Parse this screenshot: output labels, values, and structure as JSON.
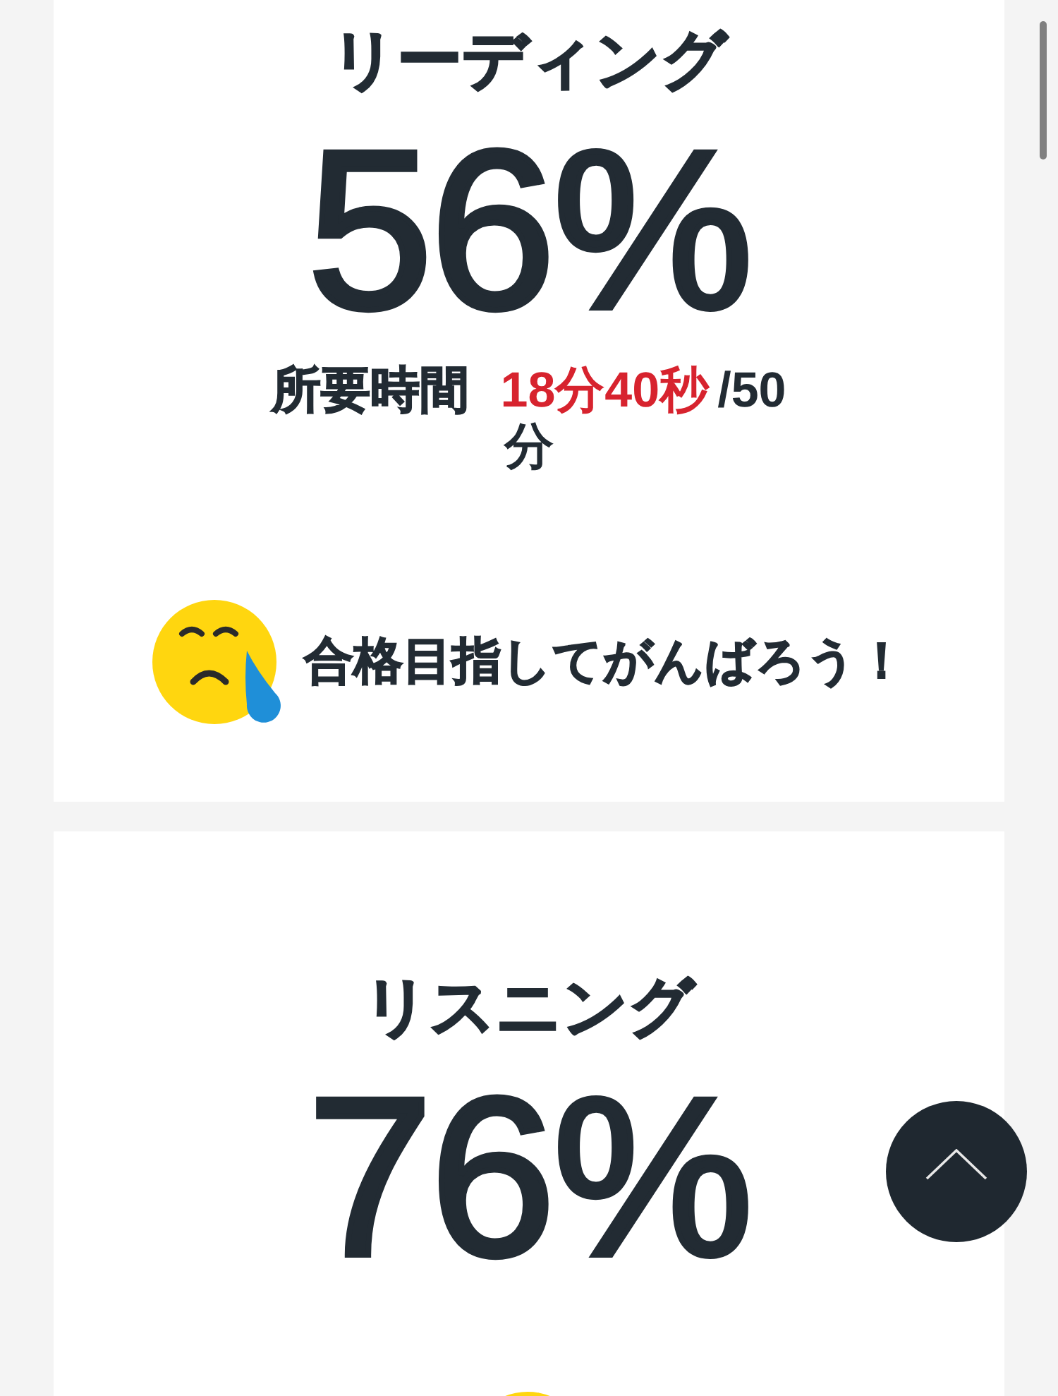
{
  "sections": [
    {
      "title": "リーディング",
      "score": "56%",
      "time": {
        "label": "所要時間",
        "elapsed": "18分40秒",
        "limit": "/50分"
      },
      "message": "合格目指してがんばろう！"
    },
    {
      "title": "リスニング",
      "score": "76%"
    }
  ]
}
